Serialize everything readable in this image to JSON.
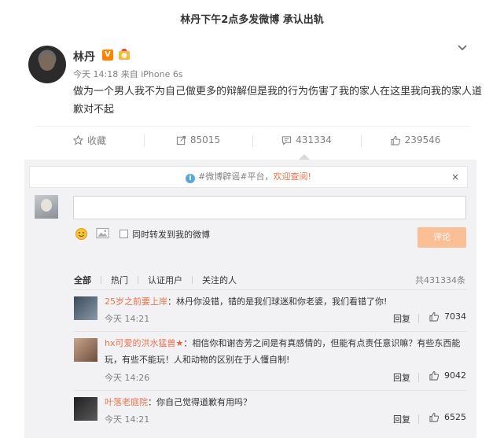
{
  "headline": "林丹下午2点多发微博 承认出轨",
  "post": {
    "author": "林丹",
    "vip_badge": "V",
    "meta_time": "今天 14:18",
    "meta_from": "来自",
    "meta_source": "iPhone 6s",
    "text": "做为一个男人我不为自己做更多的辩解但是我的行为伤害了我的家人在这里我向我的家人道歉对不起"
  },
  "actions": {
    "favorite": "收藏",
    "repost_count": "85015",
    "comment_count": "431334",
    "like_count": "239546"
  },
  "comments_box": {
    "notice_prefix": "#微博辟谣#平台，",
    "notice_link": "欢迎查阅!",
    "notice_close": "×",
    "input_value": "",
    "repost_label": "同时转发到我的微博",
    "submit_label": "评论",
    "filters": [
      "全部",
      "热门",
      "认证用户",
      "关注的人"
    ],
    "total": "共431334条"
  },
  "comments": [
    {
      "name": "25岁之前要上岸",
      "text": "：林丹你没错，错的是我们球迷和你老婆，我们看错了你!",
      "time": "今天 14:21",
      "reply": "回复",
      "likes": "7034"
    },
    {
      "name": "hx可爱的洪水猛兽",
      "badge": "★",
      "text": "：相信你和谢杏芳之间是有真感情的，但能有点责任意识嘛？有些东西能玩，有些不能玩！人和动物的区别在于人懂自制!",
      "time": "今天 14:26",
      "reply": "回复",
      "likes": "9042"
    },
    {
      "name": "叶落老庭院",
      "text": "：你自己觉得道歉有用吗？",
      "time": "今天 14:21",
      "reply": "回复",
      "likes": "6525"
    }
  ],
  "colors": {
    "accent": "#eb7350",
    "vip": "#ff8200",
    "panel": "#f2f2f5",
    "submit": "#fbbf96"
  }
}
